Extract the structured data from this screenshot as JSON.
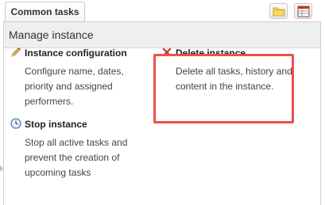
{
  "tabs": {
    "active_label": "Common tasks",
    "buttons": [
      {
        "icon": "folder-icon",
        "color": "#f4c542"
      },
      {
        "icon": "table-icon",
        "color": "#c0392b"
      }
    ]
  },
  "panel": {
    "title": "Manage instance"
  },
  "tasks": [
    {
      "title": "Instance configuration",
      "icon": "pencil-icon",
      "description": "Configure name, dates, priority and assigned performers."
    },
    {
      "title": "Delete instance",
      "icon": "delete-icon",
      "description": "Delete all tasks, history and content in the instance."
    },
    {
      "title": "Stop instance",
      "icon": "clock-icon",
      "description": "Stop all active tasks and prevent the creation of upcoming tasks"
    }
  ],
  "colors": {
    "highlight_border": "#e8534b",
    "header_bg": "#efefef"
  }
}
